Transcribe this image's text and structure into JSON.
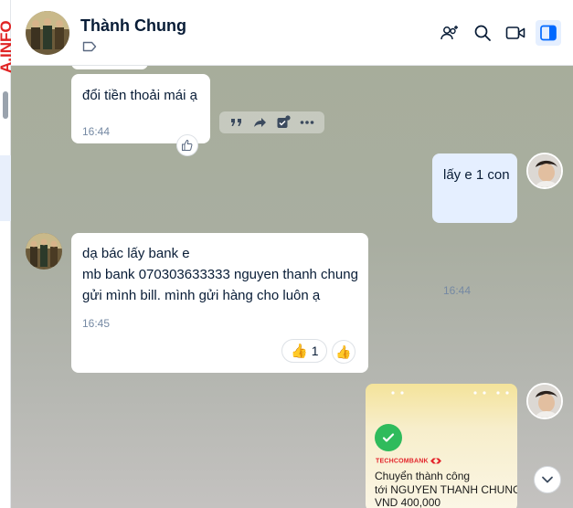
{
  "watermark": "A.INFO",
  "header": {
    "name": "Thành Chung",
    "icons": [
      "add-member-icon",
      "search-icon",
      "video-call-icon",
      "sidebar-toggle-icon"
    ]
  },
  "messages": {
    "m1": {
      "text": "đổi tiền thoải mái ạ",
      "time": "16:44"
    },
    "m2": {
      "text": "lấy e 1 con",
      "time": "16:44"
    },
    "m3": {
      "lines": [
        "dạ bác lấy bank e",
        "mb bank 070303633333 nguyen thanh chung",
        "gửi mình bill. mình gửi hàng cho luôn ạ"
      ],
      "time": "16:45",
      "reaction_count": "1"
    }
  },
  "receipt": {
    "brand": "TECHCOMBANK",
    "title": "Chuyển thành công",
    "to": "tới NGUYEN THANH CHUNG",
    "amount": "VND 400,000"
  },
  "colors": {
    "accent": "#0068ff",
    "mine_bubble": "#e5efff",
    "success": "#2fbb5c",
    "techcombank_red": "#e3242b"
  }
}
